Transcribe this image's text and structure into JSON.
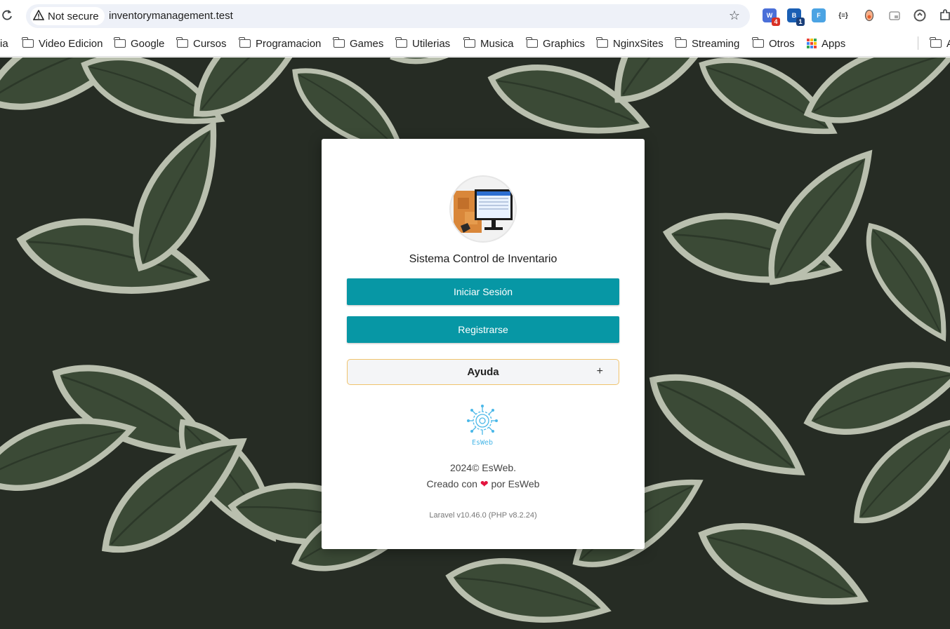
{
  "browser": {
    "security_label": "Not secure",
    "url": "inventorymanagement.test",
    "extensions": [
      {
        "name": "extension-1",
        "badge": "4",
        "color": "#4a6fd8",
        "badge_color": "#d93025"
      },
      {
        "name": "extension-2",
        "badge": "1",
        "color": "#1a5fb4",
        "badge_color": "#1a3f7a"
      },
      {
        "name": "extension-3",
        "badge": "",
        "color": "#4ba3e3",
        "badge_color": ""
      },
      {
        "name": "extension-4",
        "badge": "",
        "color": "#333333",
        "badge_color": ""
      }
    ]
  },
  "bookmarks": [
    {
      "label": "ia"
    },
    {
      "label": "Video Edicion"
    },
    {
      "label": "Google"
    },
    {
      "label": "Cursos"
    },
    {
      "label": "Programacion"
    },
    {
      "label": "Games"
    },
    {
      "label": "Utilerias"
    },
    {
      "label": "Musica"
    },
    {
      "label": "Graphics"
    },
    {
      "label": "NginxSites"
    },
    {
      "label": "Streaming"
    },
    {
      "label": "Otros"
    },
    {
      "label": "Apps"
    },
    {
      "label": "A"
    }
  ],
  "card": {
    "title": "Sistema Control de Inventario",
    "login_label": "Iniciar Sesión",
    "register_label": "Registrarse",
    "help_label": "Ayuda",
    "help_toggle": "+",
    "brand_logo_text": "EsWeb",
    "copyright": "2024© EsWeb.",
    "created_prefix": "Creado con",
    "created_suffix": "por EsWeb",
    "version": "Laravel v10.46.0 (PHP v8.2.24)"
  },
  "colors": {
    "primary_button": "#0797a5",
    "accordion_border": "#f0c36d",
    "heart": "#e3143f"
  }
}
